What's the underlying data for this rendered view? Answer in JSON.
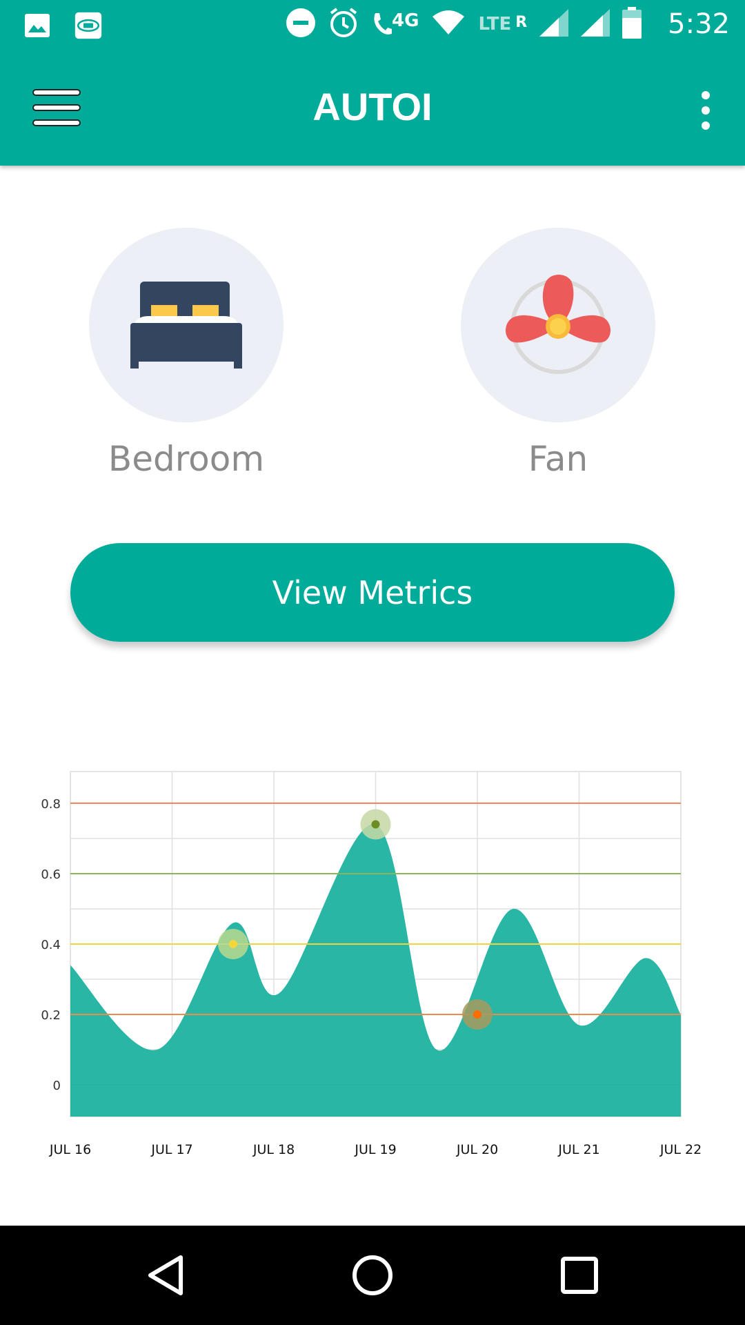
{
  "status_bar": {
    "time": "5:32",
    "network_label": "4G",
    "lte_label": "LTE",
    "roaming_label": "R",
    "icons": [
      "image-icon",
      "im-plus-icon",
      "do-not-disturb-icon",
      "alarm-icon",
      "wifi-call-icon",
      "wifi-icon",
      "signal-icon",
      "signal-icon",
      "battery-icon"
    ]
  },
  "app_bar": {
    "title": "AUTOI",
    "menu_icon": "hamburger-menu-icon",
    "overflow_icon": "more-vert-icon"
  },
  "devices": [
    {
      "label": "Bedroom",
      "icon": "bed-icon"
    },
    {
      "label": "Fan",
      "icon": "fan-icon"
    }
  ],
  "metrics_button": {
    "label": "View Metrics"
  },
  "chart_data": {
    "type": "area",
    "x": [
      "JUL 16",
      "JUL 17",
      "JUL 18",
      "JUL 19",
      "JUL 20",
      "JUL 21",
      "JUL 22"
    ],
    "y_ticks": [
      "0",
      "0.2",
      "0.4",
      "0.6",
      "0.8"
    ],
    "ylim": [
      -0.09,
      0.89
    ],
    "series": [
      {
        "points": [
          [
            0,
            0.34
          ],
          [
            0.85,
            0.1
          ],
          [
            1.6,
            0.46
          ],
          [
            2.05,
            0.26
          ],
          [
            3.0,
            0.74
          ],
          [
            3.6,
            0.1
          ],
          [
            4.35,
            0.5
          ],
          [
            5.0,
            0.17
          ],
          [
            5.65,
            0.36
          ],
          [
            6.0,
            0.2
          ]
        ],
        "color": "#26b5a3"
      }
    ],
    "threshold_lines": [
      {
        "value": 0.8,
        "color": "#e8825a"
      },
      {
        "value": 0.6,
        "color": "#8bb55a"
      },
      {
        "value": 0.4,
        "color": "#f2d43c"
      },
      {
        "value": 0.2,
        "color": "#f08a4b"
      }
    ],
    "markers": [
      {
        "x": 1.6,
        "y": 0.4,
        "color": "#f3d73a",
        "halo": "#b9d98e"
      },
      {
        "x": 3.0,
        "y": 0.74,
        "color": "#6b8e23",
        "halo": "#c5d8a5"
      },
      {
        "x": 4.0,
        "y": 0.2,
        "color": "#ff6d00",
        "halo": "#a79a5e"
      }
    ],
    "grid": true
  },
  "nav_bar": {
    "icons": [
      "back-icon",
      "home-icon",
      "recents-icon"
    ]
  }
}
